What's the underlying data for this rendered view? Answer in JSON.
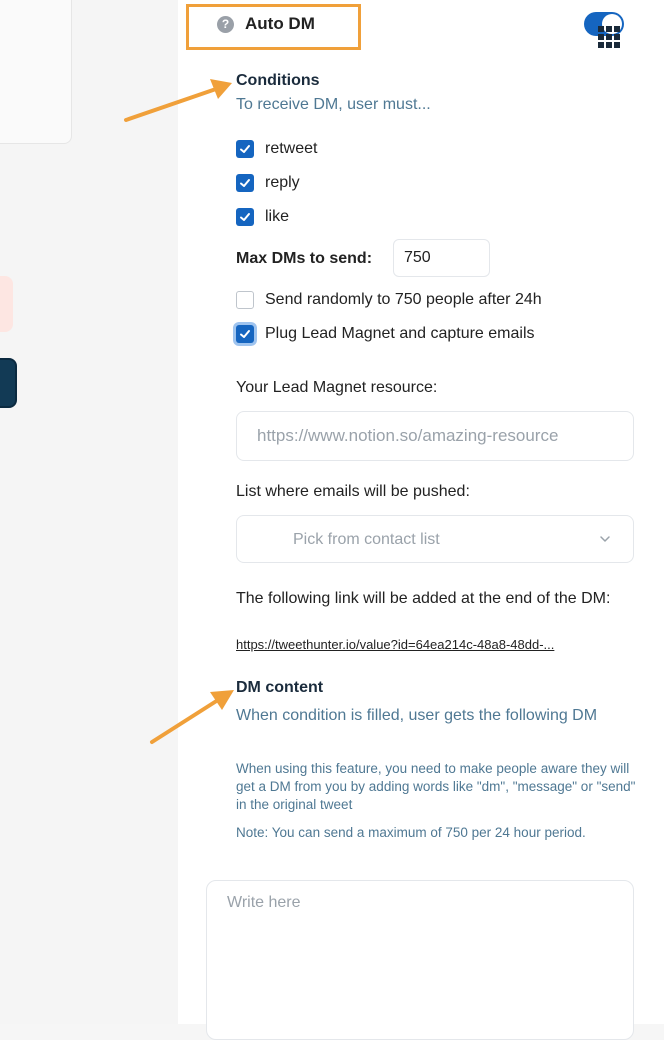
{
  "header": {
    "title": "Auto DM",
    "help_icon": "?",
    "toggle_on": true,
    "accent_color": "#f0a03a"
  },
  "conditions": {
    "heading": "Conditions",
    "subheading": "To receive DM, user must...",
    "items": [
      {
        "label": "retweet",
        "checked": true
      },
      {
        "label": "reply",
        "checked": true
      },
      {
        "label": "like",
        "checked": true
      }
    ]
  },
  "max_dms": {
    "label": "Max DMs to send:",
    "value": "750"
  },
  "options": [
    {
      "label": "Send randomly to 750 people after 24h",
      "checked": false
    },
    {
      "label": "Plug Lead Magnet and capture emails",
      "checked": true
    }
  ],
  "lead_magnet": {
    "label": "Your Lead Magnet resource:",
    "placeholder": "https://www.notion.so/amazing-resource"
  },
  "email_list": {
    "label": "List where emails will be pushed:",
    "placeholder": "Pick from contact list"
  },
  "link_info": {
    "text": "The following link will be added at the end of the DM:",
    "url": "https://tweethunter.io/value?id=64ea214c-48a8-48dd-..."
  },
  "dm_content": {
    "heading": "DM content",
    "subheading": "When condition is filled, user gets the following DM",
    "note1": "When using this feature, you need to make people aware they will get a DM from you by adding words like \"dm\", \"message\" or \"send\" in the original tweet",
    "note2": "Note: You can send a maximum of 750 per 24 hour period.",
    "placeholder": "Write here"
  },
  "colors": {
    "primary": "#1565c0",
    "muted_text": "#4f7893",
    "annotation": "#f0a03a"
  }
}
